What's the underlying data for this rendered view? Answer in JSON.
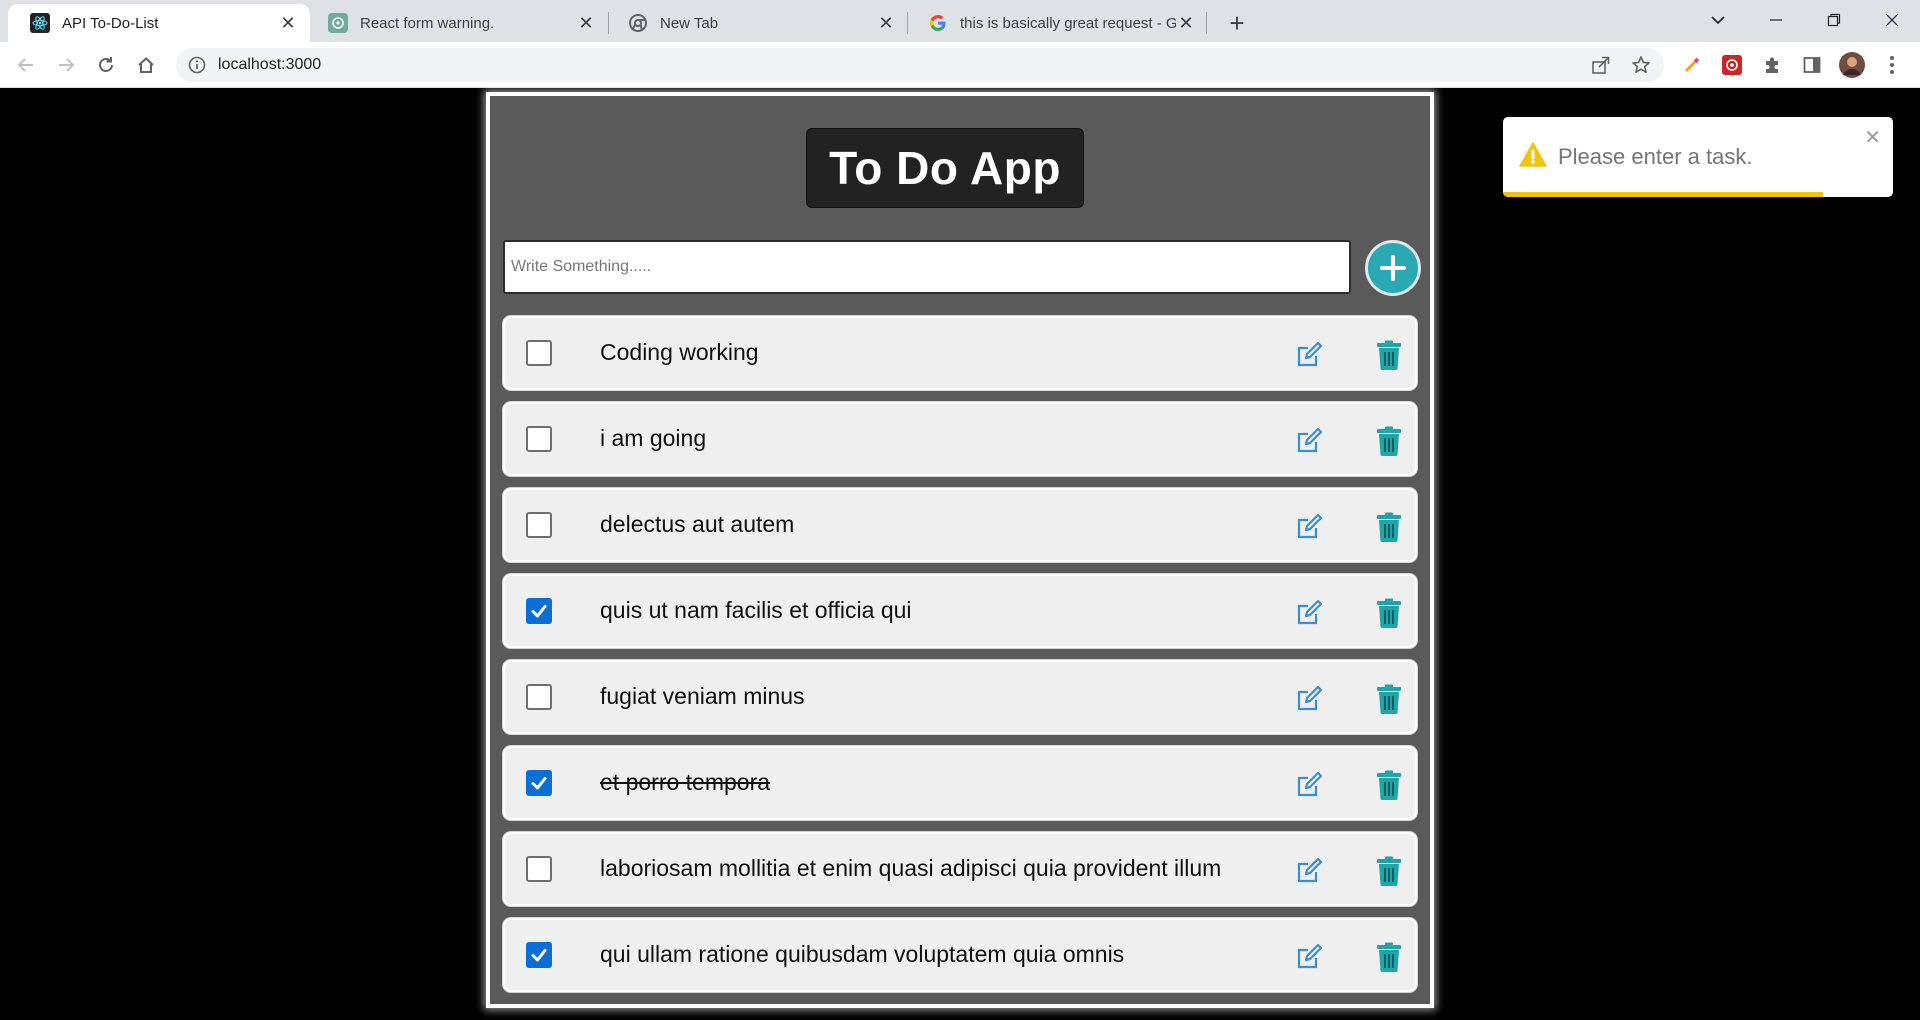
{
  "browser": {
    "tabs": [
      {
        "title": "API To-Do-List",
        "active": true,
        "icon": "react-icon"
      },
      {
        "title": "React form warning.",
        "active": false,
        "icon": "chatgpt-icon"
      },
      {
        "title": "New Tab",
        "active": false,
        "icon": "chrome-icon"
      },
      {
        "title": "this is basically great request - Go",
        "active": false,
        "icon": "google-icon"
      }
    ],
    "url": "localhost:3000"
  },
  "app": {
    "title": "To Do App",
    "input_placeholder": "Write Something.....",
    "input_value": "",
    "todos": [
      {
        "text": "Coding working",
        "checked": false,
        "strike": false
      },
      {
        "text": "i am going",
        "checked": false,
        "strike": false
      },
      {
        "text": "delectus aut autem",
        "checked": false,
        "strike": false
      },
      {
        "text": "quis ut nam facilis et officia qui",
        "checked": true,
        "strike": false
      },
      {
        "text": "fugiat veniam minus",
        "checked": false,
        "strike": false
      },
      {
        "text": "et porro tempora",
        "checked": true,
        "strike": true
      },
      {
        "text": "laboriosam mollitia et enim quasi adipisci quia provident illum",
        "checked": false,
        "strike": false
      },
      {
        "text": "qui ullam ratione quibusdam voluptatem quia omnis",
        "checked": true,
        "strike": false
      }
    ]
  },
  "toast": {
    "message": "Please enter a task.",
    "type": "warning",
    "progress": 0.82
  },
  "colors": {
    "accent_teal": "#2aa9b5",
    "edit_blue": "#3b8ed0",
    "trash_teal": "#1fa5a8",
    "checkbox_blue": "#0a6ed8",
    "warning_yellow": "#f1c40f"
  }
}
